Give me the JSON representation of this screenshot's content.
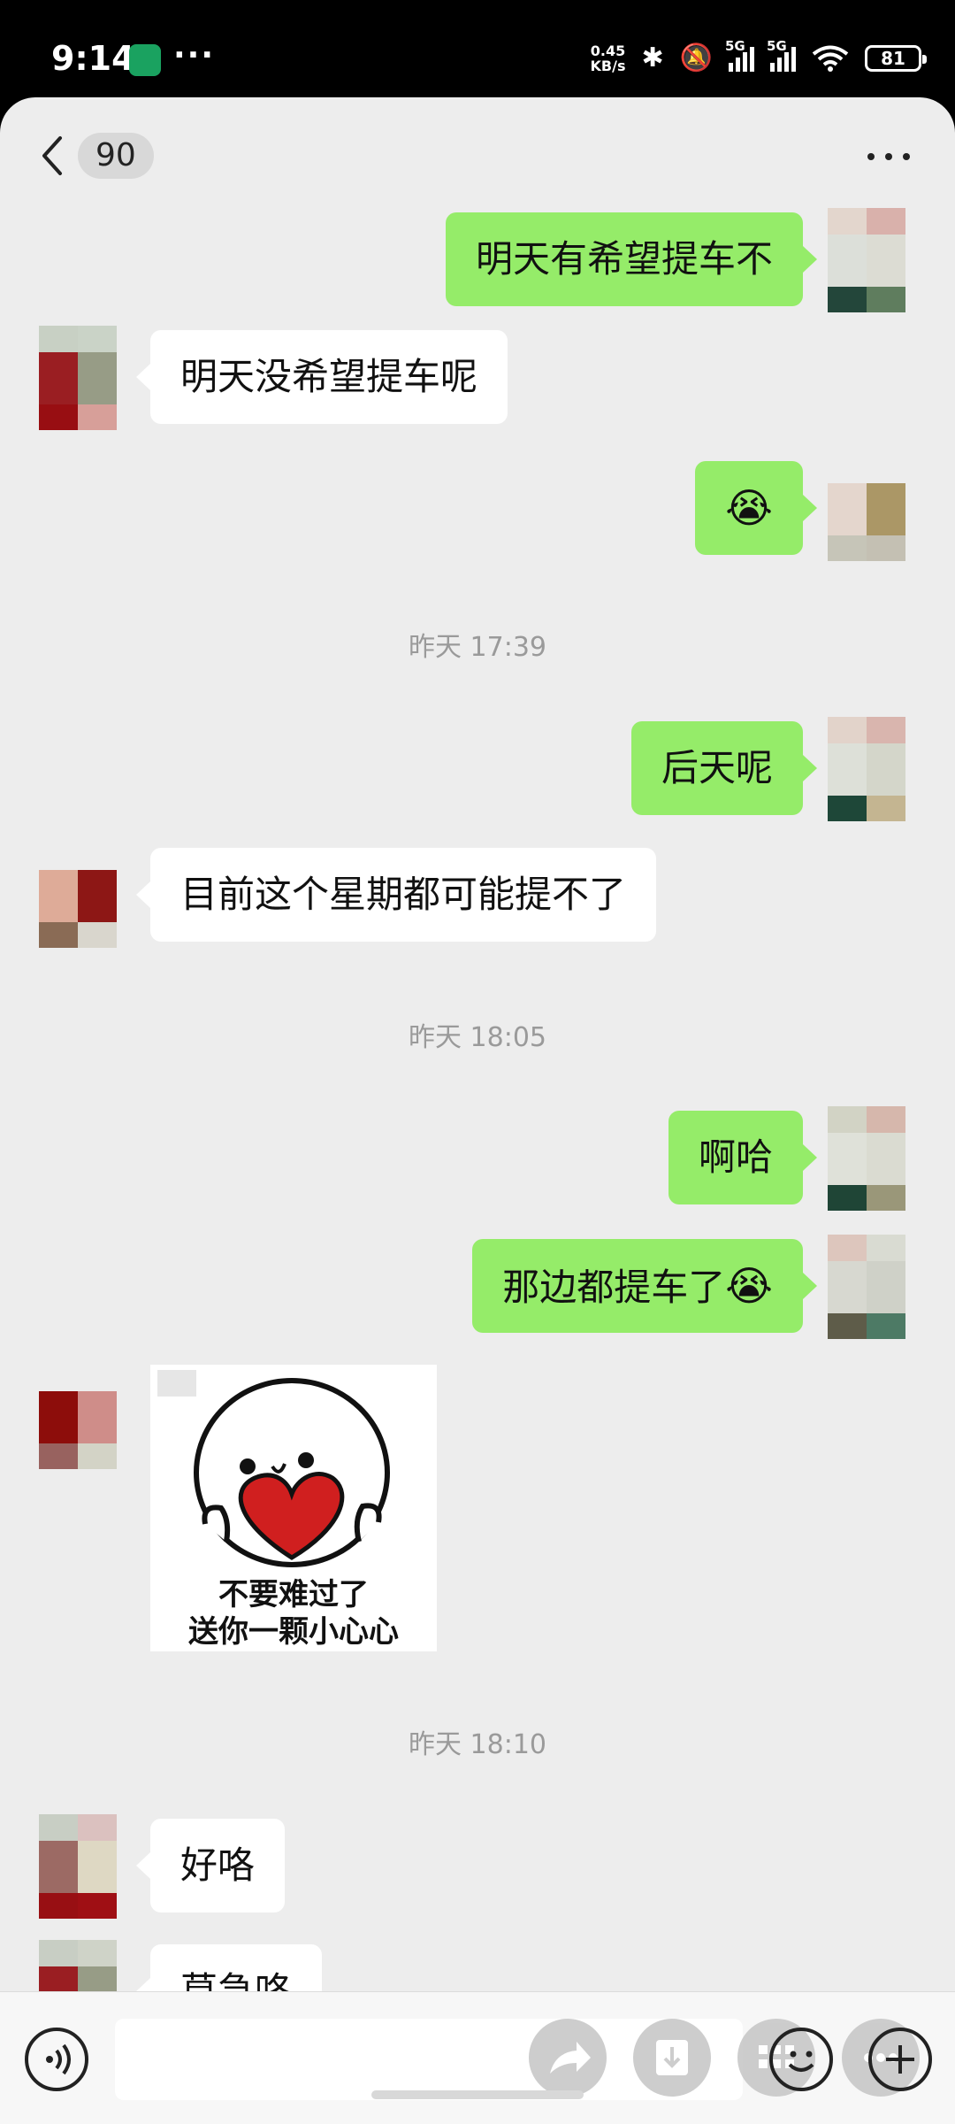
{
  "status_bar": {
    "time": "9:14",
    "dots": "···",
    "net_speed_value": "0.45",
    "net_speed_unit": "KB/s",
    "signal_1_label": "5G",
    "signal_2_label": "5G",
    "battery": "81",
    "icons": [
      "app-notification-icon",
      "bluetooth-icon",
      "mute-icon",
      "signal-icon",
      "wifi-icon",
      "battery-icon"
    ]
  },
  "header": {
    "unread_count": "90",
    "icons": [
      "back-icon",
      "more-icon"
    ]
  },
  "messages": [
    {
      "side": "right",
      "text": "明天有希望提车不"
    },
    {
      "side": "left",
      "text": "明天没希望提车呢"
    },
    {
      "side": "right",
      "emoji": "😭"
    },
    {
      "timestamp": "昨天 17:39"
    },
    {
      "side": "right",
      "text": "后天呢"
    },
    {
      "side": "left",
      "text": "目前这个星期都可能提不了"
    },
    {
      "timestamp": "昨天 18:05"
    },
    {
      "side": "right",
      "text": "啊哈"
    },
    {
      "side": "right",
      "text": "那边都提车了",
      "emoji": "😭"
    },
    {
      "side": "left",
      "sticker": {
        "line1": "不要难过了",
        "line2": "送你一颗小心心"
      }
    },
    {
      "timestamp": "昨天 18:10"
    },
    {
      "side": "left",
      "text": "好咯"
    },
    {
      "side": "left",
      "text": "莫急咯"
    }
  ],
  "bottom_bar": {
    "icons": [
      "voice-icon",
      "forward-icon",
      "download-icon",
      "multi-select-icon",
      "emoji-icon",
      "more-options-icon",
      "plus-icon"
    ]
  },
  "colors": {
    "sent_bubble": "#95ec69",
    "received_bubble": "#ffffff",
    "chat_background": "#ededed"
  }
}
